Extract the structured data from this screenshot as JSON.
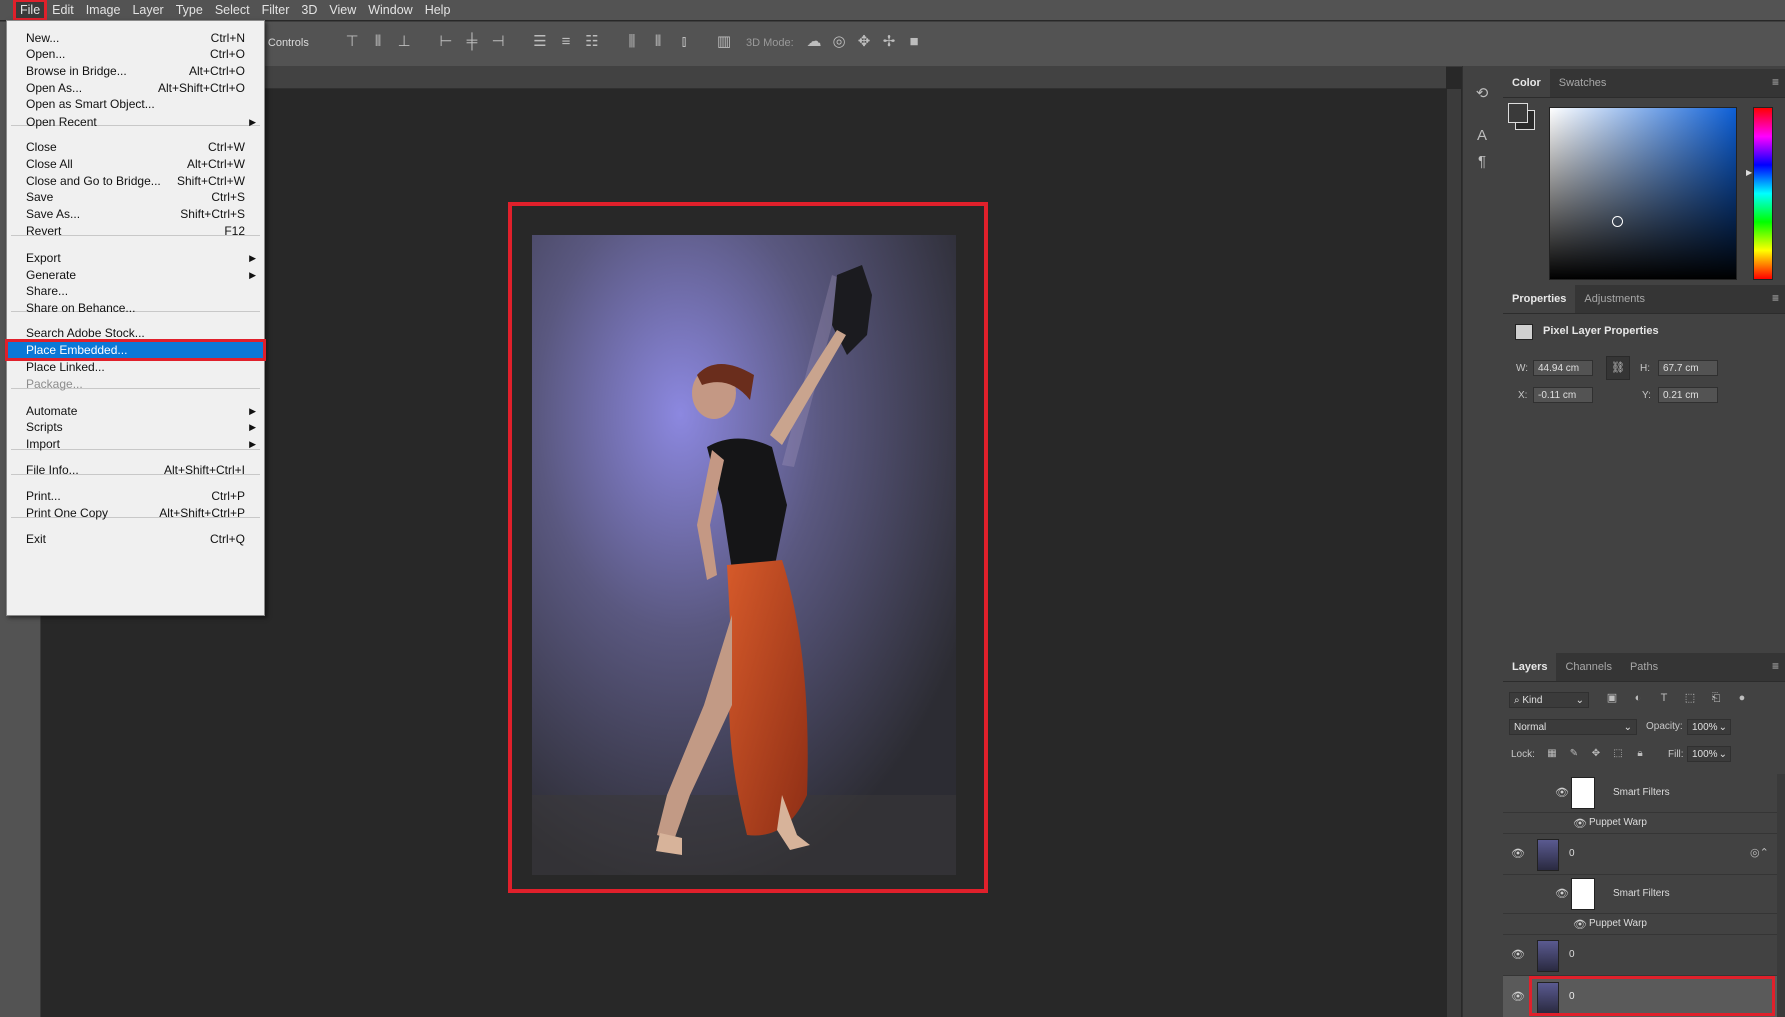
{
  "menubar": [
    "File",
    "Edit",
    "Image",
    "Layer",
    "Type",
    "Select",
    "Filter",
    "3D",
    "View",
    "Window",
    "Help"
  ],
  "options": {
    "transform_label": "rm Controls",
    "mode3d_label": "3D Mode:"
  },
  "file_menu": {
    "items": [
      {
        "label": "New...",
        "shortcut": "Ctrl+N"
      },
      {
        "label": "Open...",
        "shortcut": "Ctrl+O"
      },
      {
        "label": "Browse in Bridge...",
        "shortcut": "Alt+Ctrl+O"
      },
      {
        "label": "Open As...",
        "shortcut": "Alt+Shift+Ctrl+O"
      },
      {
        "label": "Open as Smart Object...",
        "shortcut": ""
      },
      {
        "label": "Open Recent",
        "shortcut": "",
        "submenu": true
      },
      {
        "label": "Close",
        "shortcut": "Ctrl+W"
      },
      {
        "label": "Close All",
        "shortcut": "Alt+Ctrl+W"
      },
      {
        "label": "Close and Go to Bridge...",
        "shortcut": "Shift+Ctrl+W"
      },
      {
        "label": "Save",
        "shortcut": "Ctrl+S"
      },
      {
        "label": "Save As...",
        "shortcut": "Shift+Ctrl+S"
      },
      {
        "label": "Revert",
        "shortcut": "F12"
      },
      {
        "label": "Export",
        "shortcut": "",
        "submenu": true
      },
      {
        "label": "Generate",
        "shortcut": "",
        "submenu": true
      },
      {
        "label": "Share...",
        "shortcut": ""
      },
      {
        "label": "Share on Behance...",
        "shortcut": ""
      },
      {
        "label": "Search Adobe Stock...",
        "shortcut": ""
      },
      {
        "label": "Place Embedded...",
        "shortcut": "",
        "highlighted": true
      },
      {
        "label": "Place Linked...",
        "shortcut": ""
      },
      {
        "label": "Package...",
        "shortcut": "",
        "disabled": true
      },
      {
        "label": "Automate",
        "shortcut": "",
        "submenu": true
      },
      {
        "label": "Scripts",
        "shortcut": "",
        "submenu": true
      },
      {
        "label": "Import",
        "shortcut": "",
        "submenu": true
      },
      {
        "label": "File Info...",
        "shortcut": "Alt+Shift+Ctrl+I"
      },
      {
        "label": "Print...",
        "shortcut": "Ctrl+P"
      },
      {
        "label": "Print One Copy",
        "shortcut": "Alt+Shift+Ctrl+P"
      },
      {
        "label": "Exit",
        "shortcut": "Ctrl+Q"
      }
    ]
  },
  "color_panel": {
    "tabs": [
      "Color",
      "Swatches"
    ],
    "base_hue": "#0d5fd6"
  },
  "properties_panel": {
    "tabs": [
      "Properties",
      "Adjustments"
    ],
    "title": "Pixel Layer Properties",
    "w_label": "W:",
    "w": "44.94 cm",
    "h_label": "H:",
    "h": "67.7 cm",
    "x_label": "X:",
    "x": "-0.11 cm",
    "y_label": "Y:",
    "y": "0.21 cm"
  },
  "layers_panel": {
    "tabs": [
      "Layers",
      "Channels",
      "Paths"
    ],
    "kind": "Kind",
    "blend": "Normal",
    "opacity_label": "Opacity:",
    "opacity": "100%",
    "lock_label": "Lock:",
    "fill_label": "Fill:",
    "fill": "100%",
    "rows": [
      {
        "type": "filters",
        "label": "Smart Filters"
      },
      {
        "type": "filter",
        "label": "Puppet Warp"
      },
      {
        "type": "layer",
        "label": "0"
      },
      {
        "type": "filters",
        "label": "Smart Filters"
      },
      {
        "type": "filter",
        "label": "Puppet Warp"
      },
      {
        "type": "layer",
        "label": "0"
      },
      {
        "type": "layer",
        "label": "0",
        "selected": true
      }
    ]
  }
}
